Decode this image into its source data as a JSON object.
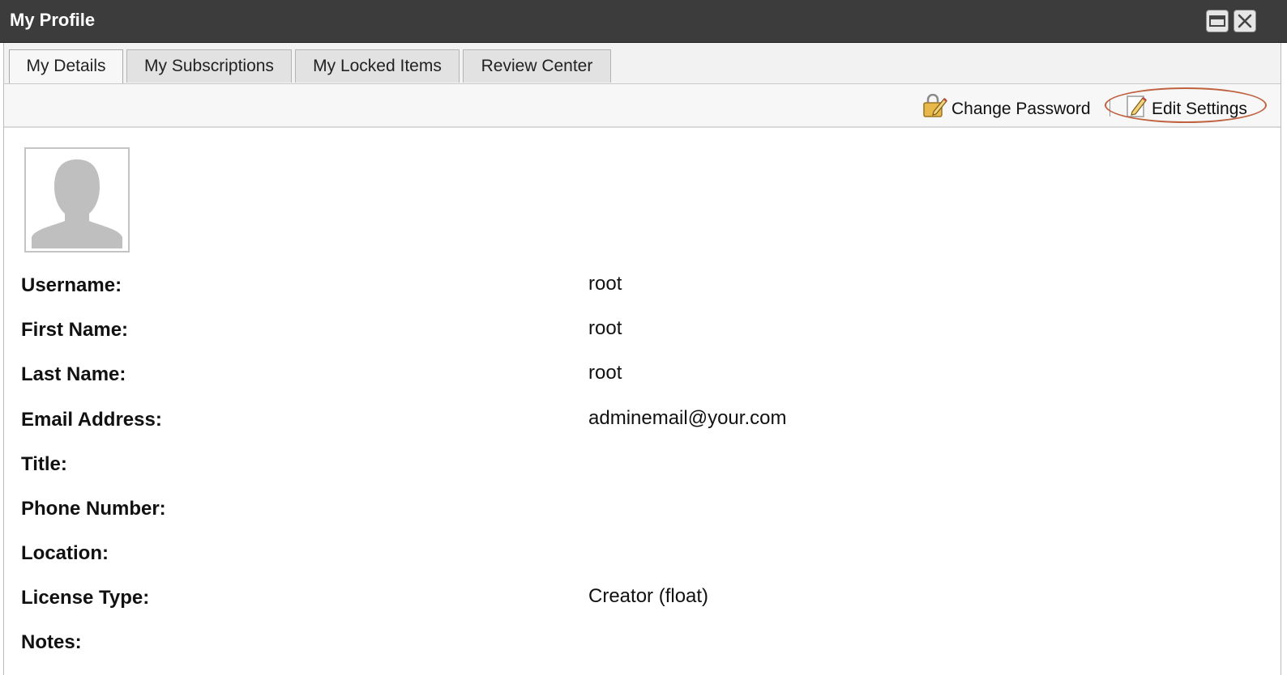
{
  "window": {
    "title": "My Profile",
    "maximize_icon": "maximize-icon",
    "close_icon": "close-icon"
  },
  "tabs": [
    {
      "label": "My Details",
      "active": true
    },
    {
      "label": "My Subscriptions",
      "active": false
    },
    {
      "label": "My Locked Items",
      "active": false
    },
    {
      "label": "Review Center",
      "active": false
    }
  ],
  "toolbar": {
    "change_password": {
      "label": "Change Password",
      "icon": "change-password-icon"
    },
    "edit_settings": {
      "label": "Edit Settings",
      "icon": "edit-icon"
    }
  },
  "avatar": {
    "icon": "default-user-avatar"
  },
  "fields": {
    "username": {
      "label": "Username:",
      "value": "root"
    },
    "first_name": {
      "label": "First Name:",
      "value": "root"
    },
    "last_name": {
      "label": "Last Name:",
      "value": "root"
    },
    "email": {
      "label": "Email Address:",
      "value": "adminemail@your.com"
    },
    "title": {
      "label": "Title:",
      "value": ""
    },
    "phone": {
      "label": "Phone Number:",
      "value": ""
    },
    "location": {
      "label": "Location:",
      "value": ""
    },
    "license": {
      "label": "License Type:",
      "value": "Creator (float)"
    },
    "notes": {
      "label": "Notes:",
      "value": ""
    }
  },
  "colors": {
    "titlebar": "#3c3c3c",
    "highlight_ring": "#c0613f",
    "toolbar_bg": "#f7f7f7"
  }
}
